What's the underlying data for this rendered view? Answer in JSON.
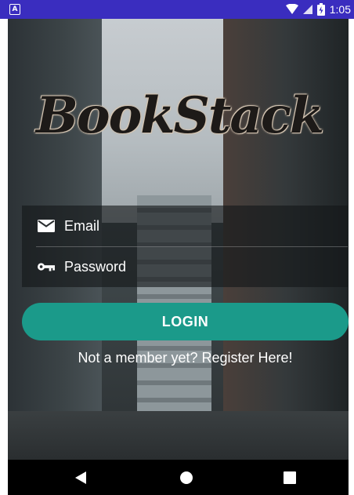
{
  "status_bar": {
    "time": "1:05",
    "left_icon_letter": "A",
    "icons": [
      "wifi-icon",
      "signal-icon",
      "battery-icon"
    ],
    "color": "#3a2dbf"
  },
  "app": {
    "logo_text": "BookStack"
  },
  "form": {
    "email_placeholder": "Email",
    "email_icon": "mail-icon",
    "password_placeholder": "Password",
    "password_icon": "key-icon"
  },
  "actions": {
    "login_label": "LOGIN",
    "register_label": "Not a member yet? Register Here!"
  },
  "navigation": {
    "buttons": [
      "back-icon",
      "home-icon",
      "recents-icon"
    ]
  },
  "colors": {
    "accent": "#1b9a8a",
    "status_bar": "#3a2dbf",
    "text": "#ffffff"
  }
}
